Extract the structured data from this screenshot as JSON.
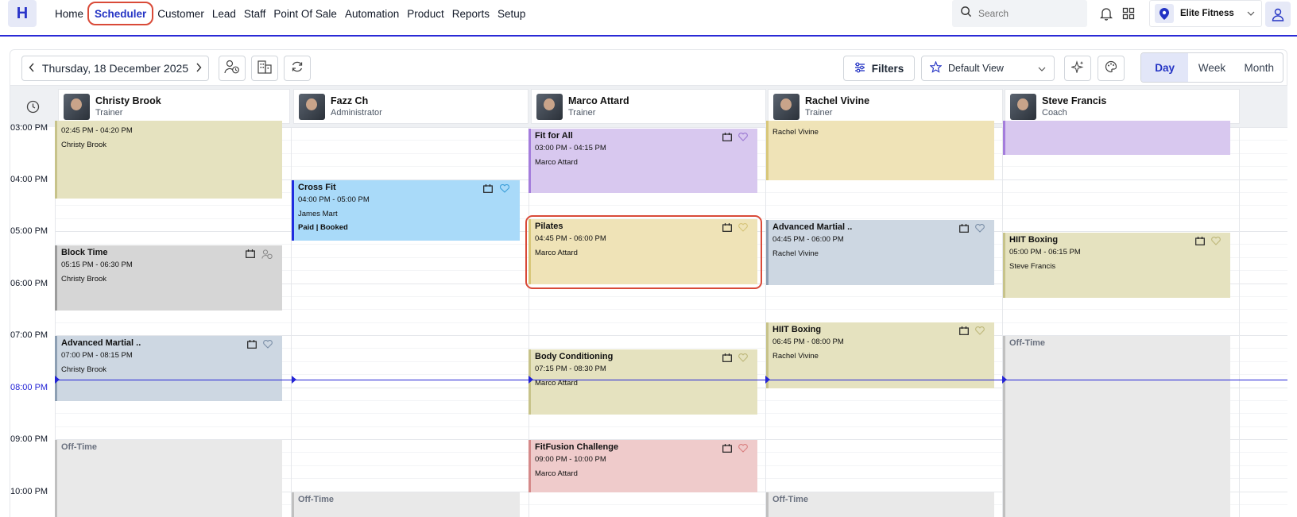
{
  "app": {
    "logo": "H",
    "nav": [
      "Home",
      "Scheduler",
      "Customer",
      "Lead",
      "Staff",
      "Point Of Sale",
      "Automation",
      "Product",
      "Reports",
      "Setup"
    ],
    "active_nav": "Scheduler",
    "search_placeholder": "Search",
    "location": "Elite Fitness",
    "accent": "#2333c4",
    "highlight_color": "#d94a38"
  },
  "toolbar": {
    "date": "Thursday, 18 December 2025",
    "filters_label": "Filters",
    "view_label": "Default View",
    "views": [
      "Day",
      "Week",
      "Month"
    ],
    "active_view": "Day"
  },
  "resources": [
    {
      "name": "Christy Brook",
      "role": "Trainer"
    },
    {
      "name": "Fazz Ch",
      "role": "Administrator"
    },
    {
      "name": "Marco Attard",
      "role": "Trainer"
    },
    {
      "name": "Rachel Vivine",
      "role": "Trainer"
    },
    {
      "name": "Steve Francis",
      "role": "Coach"
    }
  ],
  "time_labels": [
    "03:00 PM",
    "04:00 PM",
    "05:00 PM",
    "06:00 PM",
    "07:00 PM",
    "08:00 PM",
    "09:00 PM",
    "10:00 PM"
  ],
  "current_time_label": "08:00 PM",
  "events": {
    "cb1": {
      "title": "",
      "time": "02:45 PM - 04:20 PM",
      "staff": "Christy Brook"
    },
    "cb2": {
      "title": "Block Time",
      "time": "05:15 PM - 06:30 PM",
      "staff": "Christy Brook"
    },
    "cb3": {
      "title": "Advanced Martial ..",
      "time": "07:00 PM - 08:15 PM",
      "staff": "Christy Brook"
    },
    "cb4": {
      "title": "Off-Time"
    },
    "fz1": {
      "title": "Cross Fit",
      "time": "04:00 PM - 05:00 PM",
      "staff": "James Mart",
      "status": "Paid | Booked"
    },
    "fz2": {
      "title": "Off-Time"
    },
    "ma1": {
      "title": "Fit for All",
      "time": "03:00 PM - 04:15 PM",
      "staff": "Marco Attard"
    },
    "ma2": {
      "title": "Pilates",
      "time": "04:45 PM - 06:00 PM",
      "staff": "Marco Attard"
    },
    "ma3": {
      "title": "Body Conditioning",
      "time": "07:15 PM - 08:30 PM",
      "staff": "Marco Attard"
    },
    "ma4": {
      "title": "FitFusion Challenge",
      "time": "09:00 PM - 10:00 PM",
      "staff": "Marco Attard"
    },
    "rv1": {
      "staff": "Rachel Vivine"
    },
    "rv2": {
      "title": "Advanced Martial ..",
      "time": "04:45 PM - 06:00 PM",
      "staff": "Rachel Vivine"
    },
    "rv3": {
      "title": "HIIT Boxing",
      "time": "06:45 PM - 08:00 PM",
      "staff": "Rachel Vivine"
    },
    "rv4": {
      "title": "Off-Time"
    },
    "sf1": {
      "title": "HIIT Boxing",
      "time": "05:00 PM - 06:15 PM",
      "staff": "Steve Francis"
    },
    "sf2": {
      "title": "Off-Time"
    }
  }
}
